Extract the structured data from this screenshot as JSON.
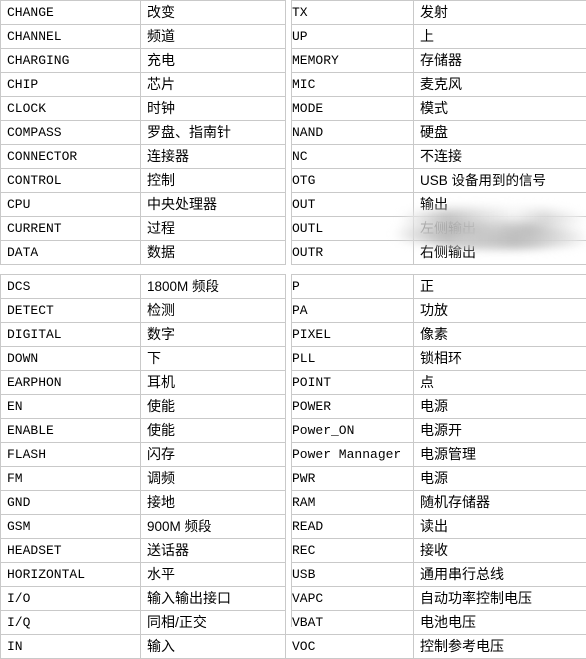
{
  "document": {
    "kind": "bilingual-glossary",
    "language_pair": "English-Chinese",
    "column_headers_visible": false
  },
  "tables": [
    {
      "id": "table-top",
      "rows": [
        {
          "term_a": "CHANGE",
          "meaning_a": "改变",
          "term_b": "TX",
          "meaning_b": "发射"
        },
        {
          "term_a": "CHANNEL",
          "meaning_a": "频道",
          "term_b": "UP",
          "meaning_b": "上"
        },
        {
          "term_a": "CHARGING",
          "meaning_a": "充电",
          "term_b": "MEMORY",
          "meaning_b": "存储器"
        },
        {
          "term_a": "CHIP",
          "meaning_a": "芯片",
          "term_b": "MIC",
          "meaning_b": "麦克风"
        },
        {
          "term_a": "CLOCK",
          "meaning_a": "时钟",
          "term_b": "MODE",
          "meaning_b": "模式"
        },
        {
          "term_a": "COMPASS",
          "meaning_a": "罗盘、指南针",
          "term_b": "NAND",
          "meaning_b": "硬盘"
        },
        {
          "term_a": "CONNECTOR",
          "meaning_a": "连接器",
          "term_b": "NC",
          "meaning_b": "不连接"
        },
        {
          "term_a": "CONTROL",
          "meaning_a": "控制",
          "term_b": "OTG",
          "meaning_b": "USB 设备用到的信号"
        },
        {
          "term_a": "CPU",
          "meaning_a": "中央处理器",
          "term_b": "OUT",
          "meaning_b": "输出"
        },
        {
          "term_a": "CURRENT",
          "meaning_a": "过程",
          "term_b": "OUTL",
          "meaning_b": "左侧输出"
        },
        {
          "term_a": "DATA",
          "meaning_a": "数据",
          "term_b": "OUTR",
          "meaning_b": "右侧输出"
        }
      ]
    },
    {
      "id": "table-bottom",
      "rows": [
        {
          "term_a": "DCS",
          "meaning_a": "1800M 频段",
          "term_b": "P",
          "meaning_b": "正"
        },
        {
          "term_a": "DETECT",
          "meaning_a": "检测",
          "term_b": "PA",
          "meaning_b": "功放"
        },
        {
          "term_a": "DIGITAL",
          "meaning_a": "数字",
          "term_b": "PIXEL",
          "meaning_b": "像素"
        },
        {
          "term_a": "DOWN",
          "meaning_a": "下",
          "term_b": "PLL",
          "meaning_b": "锁相环"
        },
        {
          "term_a": "EARPHON",
          "meaning_a": "耳机",
          "term_b": "POINT",
          "meaning_b": "点"
        },
        {
          "term_a": "EN",
          "meaning_a": "使能",
          "term_b": "POWER",
          "meaning_b": "电源"
        },
        {
          "term_a": "ENABLE",
          "meaning_a": "使能",
          "term_b": "Power_ON",
          "meaning_b": "电源开"
        },
        {
          "term_a": "FLASH",
          "meaning_a": "闪存",
          "term_b": "Power Mannager",
          "meaning_b": "电源管理"
        },
        {
          "term_a": "FM",
          "meaning_a": "调频",
          "term_b": "PWR",
          "meaning_b": "电源"
        },
        {
          "term_a": "GND",
          "meaning_a": "接地",
          "term_b": "RAM",
          "meaning_b": "随机存储器"
        },
        {
          "term_a": "GSM",
          "meaning_a": "900M 频段",
          "term_b": "READ",
          "meaning_b": "读出"
        },
        {
          "term_a": "HEADSET",
          "meaning_a": "送话器",
          "term_b": "REC",
          "meaning_b": "接收"
        },
        {
          "term_a": "HORIZONTAL",
          "meaning_a": "水平",
          "term_b": "USB",
          "meaning_b": "通用串行总线"
        },
        {
          "term_a": "I/O",
          "meaning_a": "输入输出接口",
          "term_b": "VAPC",
          "meaning_b": "自动功率控制电压"
        },
        {
          "term_a": "I/Q",
          "meaning_a": "同相/正交",
          "term_b": "VBAT",
          "meaning_b": "电池电压"
        },
        {
          "term_a": "IN",
          "meaning_a": "输入",
          "term_b": "VOC",
          "meaning_b": "控制参考电压"
        }
      ]
    }
  ],
  "artifacts": {
    "smudge_label": "blurred-grey-smudge-overlay",
    "smudge_note": "grey blurred streak covering OUTL / OUTR meaning cells"
  },
  "colors": {
    "background": "#ffffff",
    "text": "#000000",
    "grid_line": "#c9c9c9",
    "smudge": "#c4c4c4"
  }
}
